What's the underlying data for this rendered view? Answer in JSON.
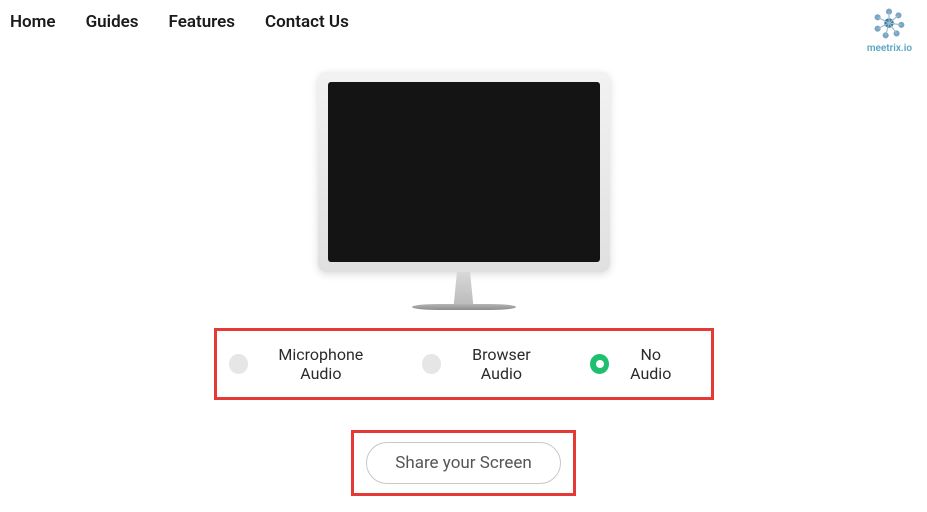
{
  "nav": {
    "home": "Home",
    "guides": "Guides",
    "features": "Features",
    "contact": "Contact Us"
  },
  "logo": {
    "text": "meetrix.io"
  },
  "audio_options": {
    "microphone": {
      "label": "Microphone Audio",
      "selected": false
    },
    "browser": {
      "label": "Browser Audio",
      "selected": false
    },
    "none": {
      "label": "No Audio",
      "selected": true
    }
  },
  "share_button": "Share your Screen"
}
